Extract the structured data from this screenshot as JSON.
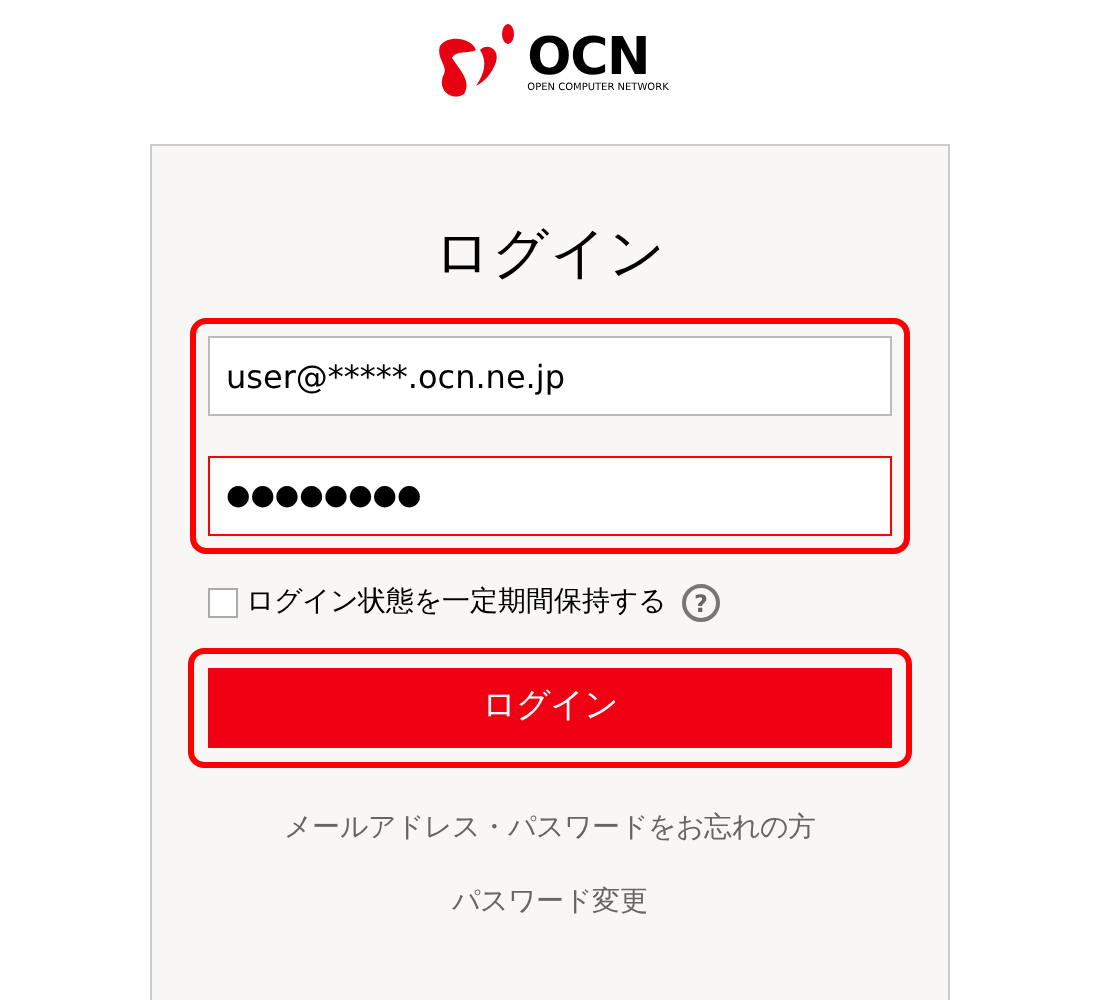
{
  "logo": {
    "name": "OCN",
    "tagline": "OPEN COMPUTER NETWORK"
  },
  "title": "ログイン",
  "email_field": {
    "value": "user@*****.ocn.ne.jp",
    "highlighted": true
  },
  "password_field": {
    "value": "●●●●●●●●",
    "error": true
  },
  "remember": {
    "label": "ログイン状態を一定期間保持する",
    "checked": false,
    "help": "?"
  },
  "login_button": {
    "label": "ログイン",
    "highlighted": true
  },
  "links": [
    "メールアドレス・パスワードをお忘れの方",
    "パスワード変更"
  ]
}
